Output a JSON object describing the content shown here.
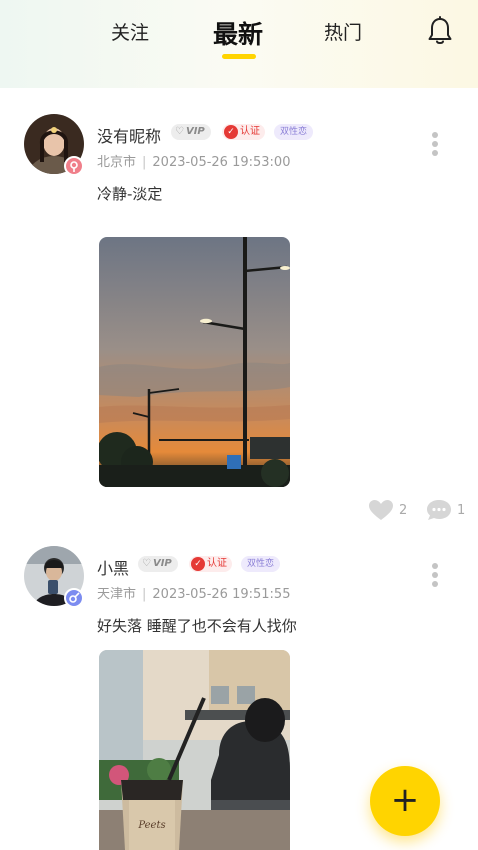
{
  "header": {
    "tabs": [
      {
        "label": "关注"
      },
      {
        "label": "最新",
        "active": true
      },
      {
        "label": "热门"
      }
    ],
    "accent_color": "#ffd400",
    "icons": {
      "notification": "bell-icon"
    }
  },
  "posts": [
    {
      "username": "没有昵称",
      "vip": "VIP",
      "certified": "认证",
      "tag": "双性恋",
      "location": "北京市",
      "separator": "|",
      "timestamp": "2023-05-26 19:53:00",
      "content": "冷静-淡定",
      "image": "sunset-street-lamp-photo",
      "likes": "2",
      "comments": "1"
    },
    {
      "username": "小黑",
      "vip": "VIP",
      "certified": "认证",
      "tag": "双性恋",
      "location": "天津市",
      "separator": "|",
      "timestamp": "2023-05-26 19:51:55",
      "content": "好失落 睡醒了也不会有人找你",
      "image": "coffee-cup-cafe-photo"
    }
  ],
  "fab": {
    "label": "+",
    "color": "#ffd400"
  }
}
